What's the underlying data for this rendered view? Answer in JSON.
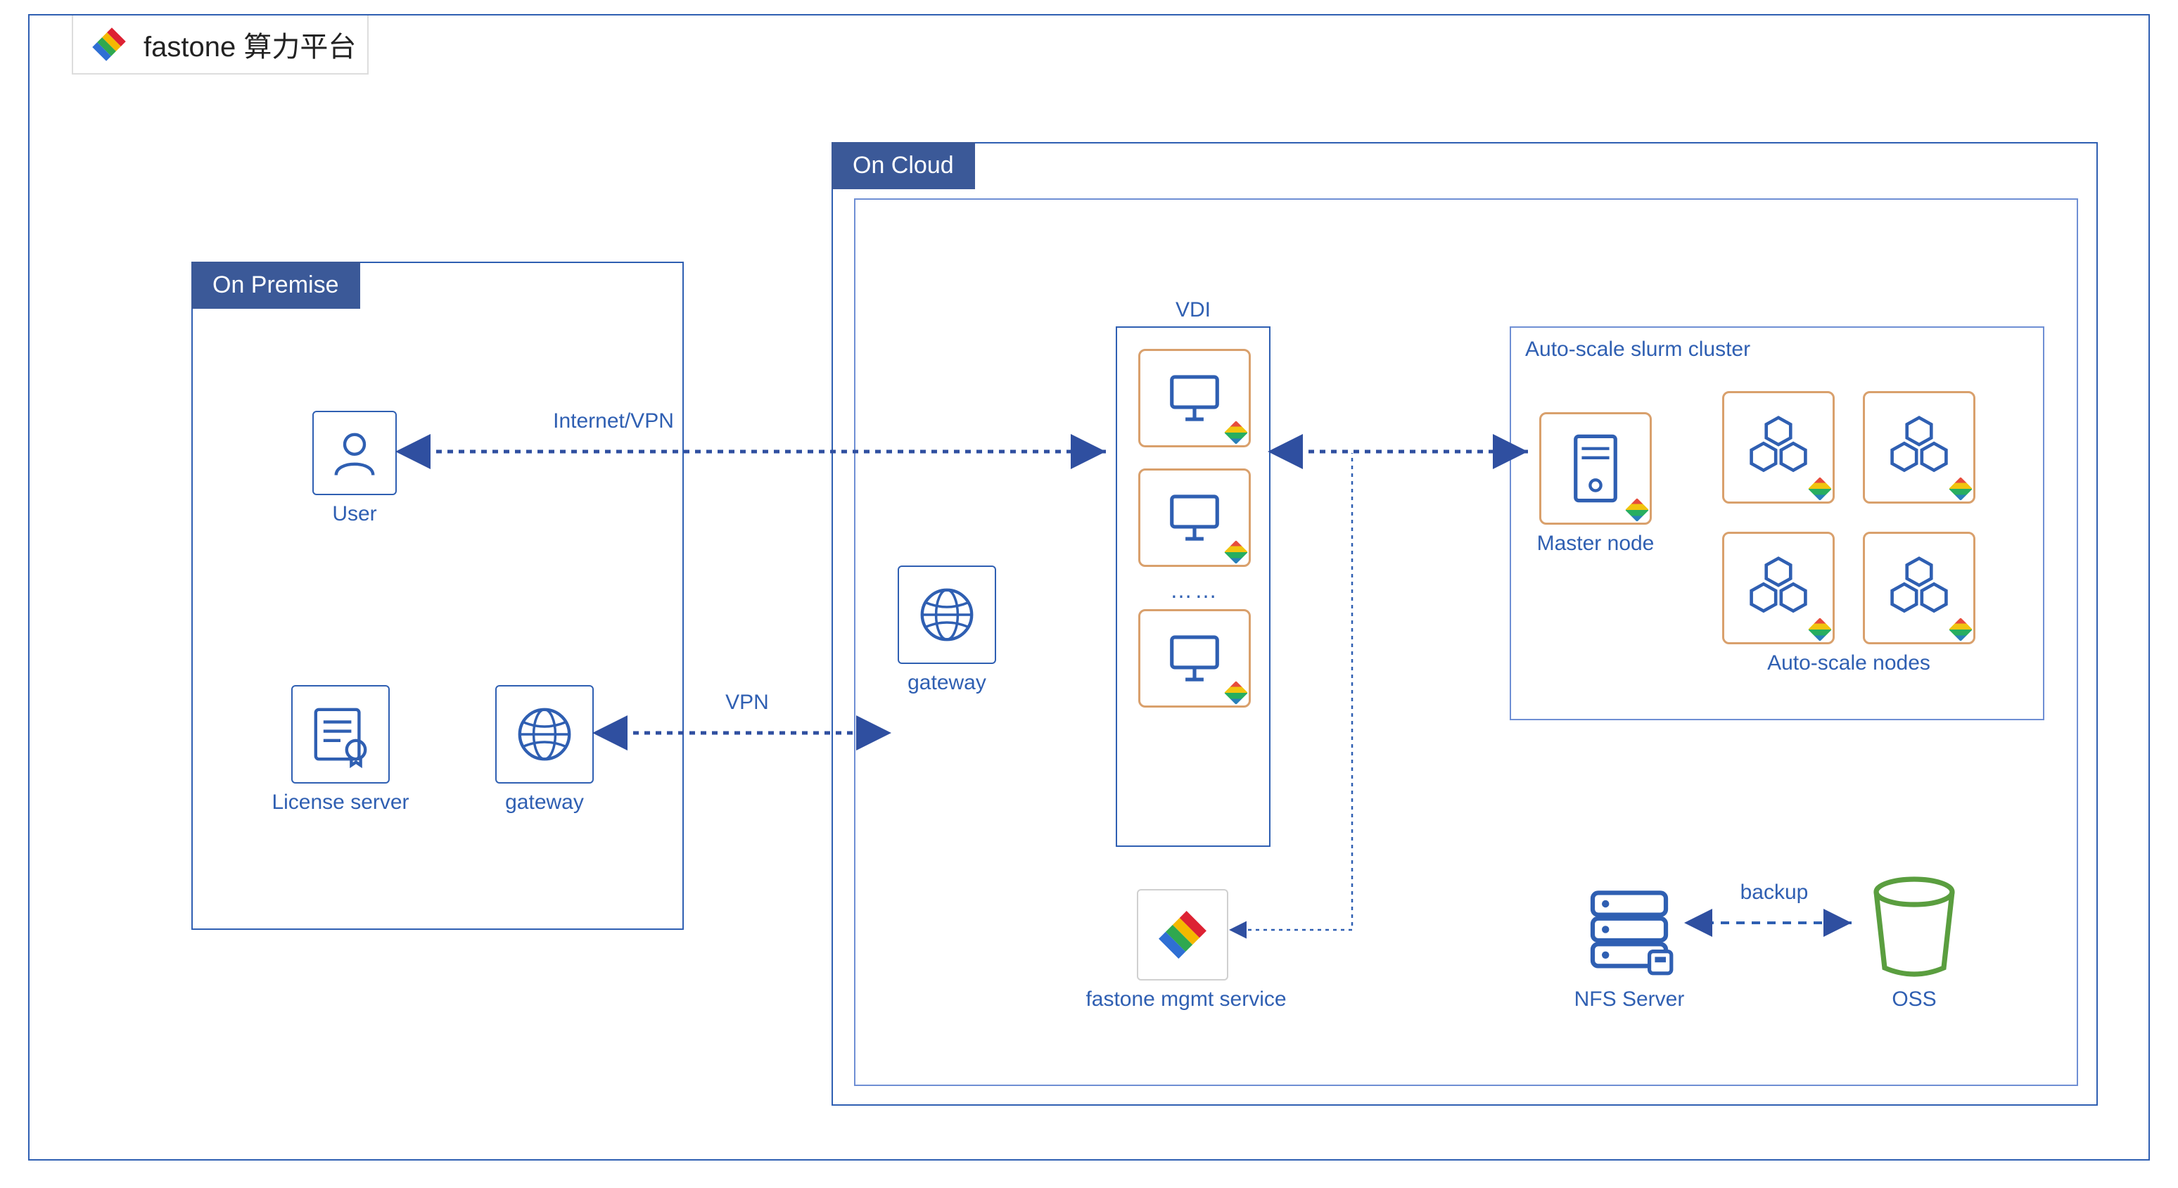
{
  "title": "fastone 算力平台",
  "panels": {
    "premise": "On Premise",
    "cloud": "On Cloud"
  },
  "nodes": {
    "user": "User",
    "license": "License server",
    "gateway1": "gateway",
    "gateway2": "gateway",
    "vdi": "VDI",
    "vdi_more": "……",
    "autoscale": "Auto-scale slurm cluster",
    "master": "Master node",
    "auto_nodes": "Auto-scale nodes",
    "mgmt": "fastone mgmt service",
    "nfs": "NFS Server",
    "oss": "OSS"
  },
  "edges": {
    "internet_vpn": "Internet/VPN",
    "vpn": "VPN",
    "backup": "backup"
  }
}
